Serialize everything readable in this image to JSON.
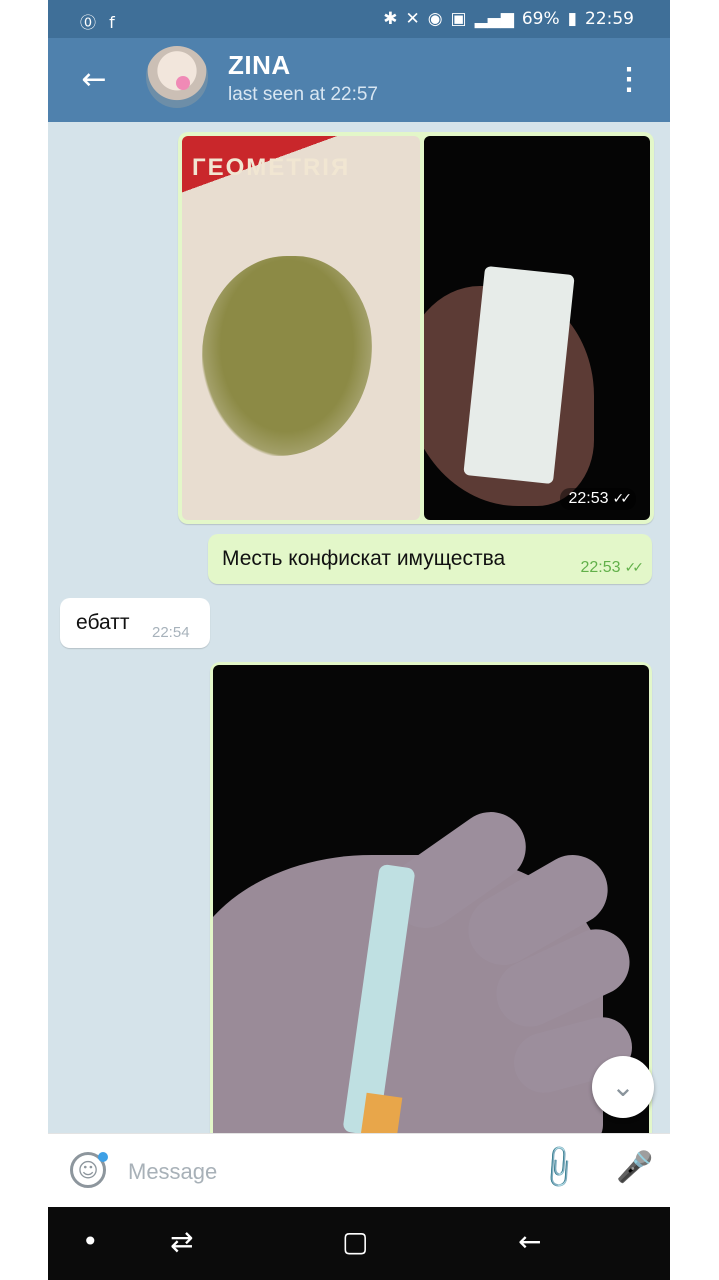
{
  "status_bar": {
    "left_icons": "⓪ f",
    "icons": [
      "bluetooth-icon",
      "mute-icon",
      "alarm-icon",
      "sim-icon",
      "signal-icon"
    ],
    "battery": "69%",
    "time": "22:59"
  },
  "header": {
    "back": "←",
    "title": "ZINA",
    "subtitle": "last seen at 22:57",
    "menu": "⋮"
  },
  "messages": {
    "album_book_text": "ГЕОМЕТRIЯ",
    "album_time": "22:53",
    "album_check": "✓✓",
    "msg1_text": "Месть конфискат имущества",
    "msg1_time": "22:53",
    "msg1_check": "✓✓",
    "msg2_text": "ебатт",
    "msg2_time": "22:54"
  },
  "scroll_down": "⌄",
  "input": {
    "emoji": "☺",
    "placeholder": "Message",
    "attach": "📎",
    "mic": "🎤"
  },
  "navbar": {
    "dot": "•",
    "recent": "⇄",
    "home": "▢",
    "back": "←"
  },
  "colors": {
    "header": "#4f81ad",
    "statusbar": "#3f6f98",
    "outgoing_bubble": "#e3f7c9",
    "incoming_bubble": "#ffffff",
    "chat_background": "#d5e3ea"
  }
}
